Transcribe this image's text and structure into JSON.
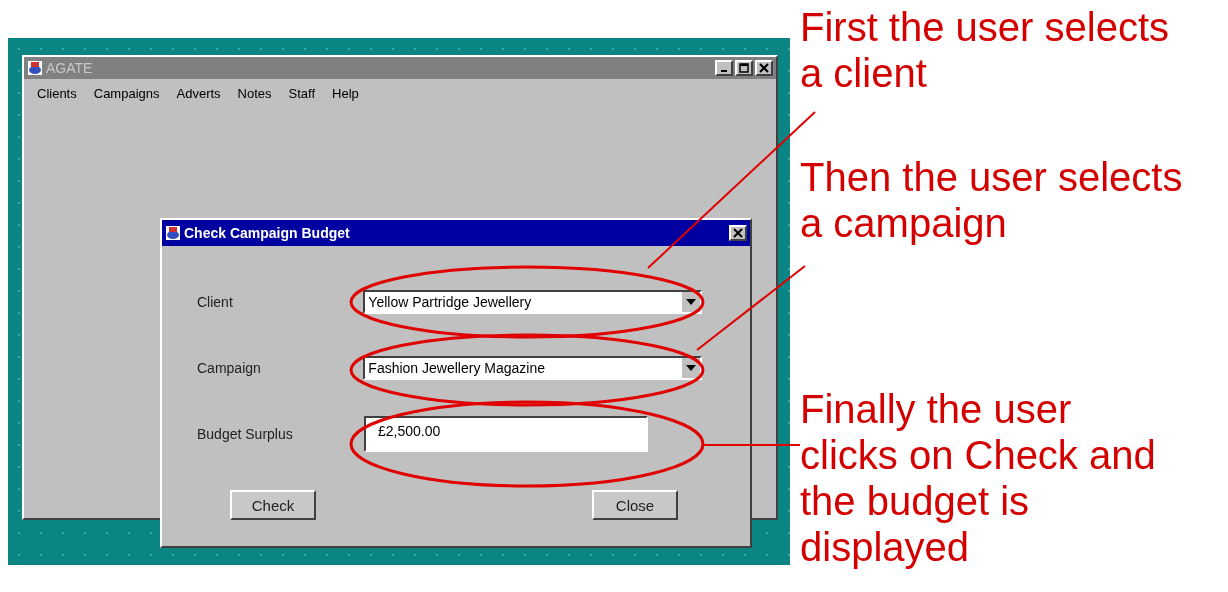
{
  "desktop": {
    "main_window": {
      "title": "AGATE",
      "active": false,
      "menu": [
        "Clients",
        "Campaigns",
        "Adverts",
        "Notes",
        "Staff",
        "Help"
      ]
    },
    "dialog": {
      "title": "Check Campaign Budget",
      "active": true,
      "fields": [
        {
          "kind": "dropdown",
          "label": "Client",
          "value": "Yellow Partridge Jewellery"
        },
        {
          "kind": "dropdown",
          "label": "Campaign",
          "value": "Fashion Jewellery Magazine"
        },
        {
          "kind": "text",
          "label": "Budget Surplus",
          "value": "£2,500.00"
        }
      ],
      "buttons": [
        "Check",
        "Close"
      ]
    }
  },
  "annotations": [
    {
      "text": "First the user selects a client"
    },
    {
      "text": "Then the user selects a campaign"
    },
    {
      "text": "Finally the user clicks on Check and the budget is displayed"
    }
  ]
}
